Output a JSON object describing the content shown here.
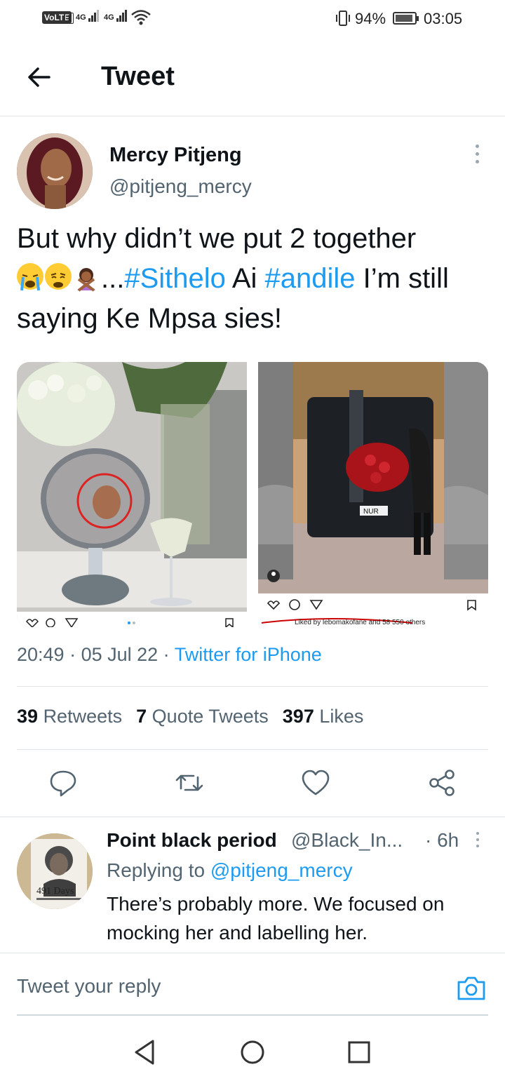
{
  "status_bar": {
    "volte": "VoLTE",
    "sim": "1",
    "net1": "4G",
    "net2": "4G",
    "battery_pct": "94%",
    "battery_level": 0.94,
    "time": "03:05",
    "icons": [
      "signal-icon",
      "wifi-icon",
      "vibrate-icon",
      "battery-icon"
    ]
  },
  "header": {
    "title": "Tweet",
    "back_icon": "arrow-left-icon"
  },
  "tweet": {
    "author_name": "Mercy Pitjeng",
    "author_handle": "@pitjeng_mercy",
    "text_1": "But why didn’t we put 2 together",
    "ellipsis": "...",
    "tag_1": "#Sithelo",
    "mid_text": " Ai ",
    "tag_2": "#andile",
    "text_2": " I’m still saying Ke Mpsa sies!",
    "emojis": [
      "loudly-crying-face",
      "weary-face",
      "person-gesturing-no"
    ],
    "media": [
      {
        "desc": "mirror-selfie-photo",
        "footer_icons": [
          "heart-icon",
          "comment-icon",
          "send-icon",
          "bookmark-icon"
        ]
      },
      {
        "desc": "car-with-roses-photo",
        "plate": "NUR",
        "liked_by": "Liked by lebomakofane and 58 550 others",
        "footer_icons": [
          "heart-icon",
          "comment-icon",
          "send-icon",
          "bookmark-icon"
        ]
      }
    ],
    "time": "20:49",
    "date": "05 Jul 22",
    "source": "Twitter for iPhone",
    "sep": " · "
  },
  "stats": {
    "retweets_count": "39",
    "retweets_label": "Retweets",
    "quotes_count": "7",
    "quotes_label": "Quote Tweets",
    "likes_count": "397",
    "likes_label": "Likes"
  },
  "actions": [
    "reply-icon",
    "retweet-icon",
    "like-icon",
    "share-icon"
  ],
  "reply": {
    "name": "Point black period",
    "handle": "@Black_In...",
    "time": "· 6h",
    "replying_prefix": "Replying to ",
    "replying_to": "@pitjeng_mercy",
    "text": "There’s probably more. We focused on mocking her and labelling her.",
    "avatar_text": "491 Days"
  },
  "compose": {
    "placeholder": "Tweet your reply",
    "camera_icon": "camera-icon"
  },
  "nav": [
    "back-nav-icon",
    "home-nav-icon",
    "recents-nav-icon"
  ],
  "colors": {
    "accent": "#1d9bf0",
    "text": "#0f1419",
    "secondary": "#536471"
  }
}
